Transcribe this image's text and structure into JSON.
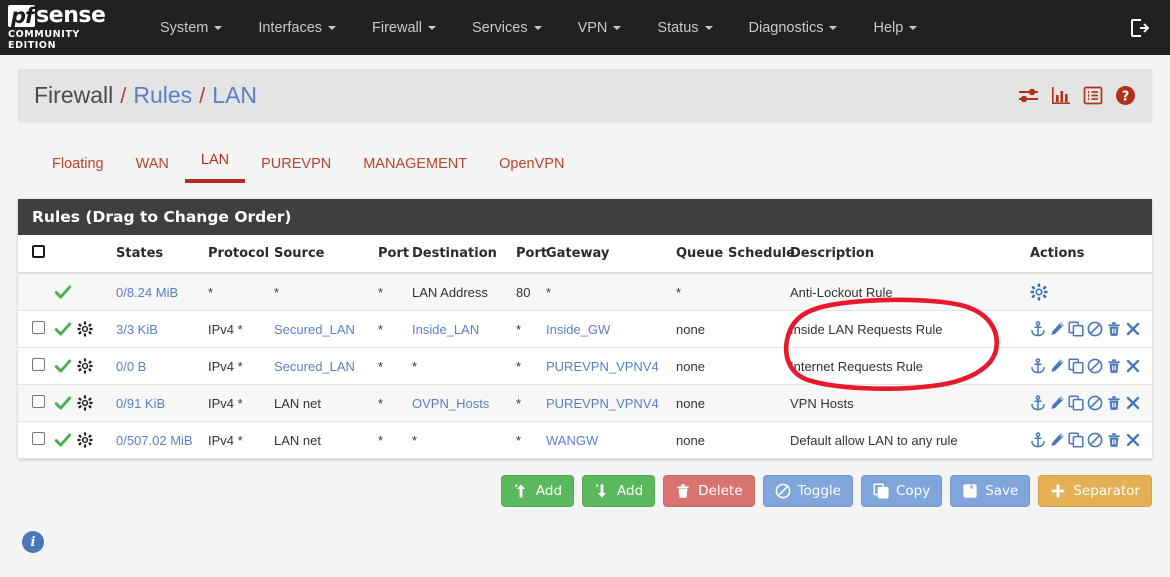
{
  "navbar": {
    "brand": {
      "pf": "pf",
      "sense": "sense",
      "edition": "COMMUNITY EDITION"
    },
    "items": [
      {
        "label": "System"
      },
      {
        "label": "Interfaces"
      },
      {
        "label": "Firewall"
      },
      {
        "label": "Services"
      },
      {
        "label": "VPN"
      },
      {
        "label": "Status"
      },
      {
        "label": "Diagnostics"
      },
      {
        "label": "Help"
      }
    ],
    "logout_icon": "logout-icon"
  },
  "page_head": {
    "crumbs": [
      {
        "label": "Firewall",
        "link": false
      },
      {
        "label": "Rules",
        "link": true
      },
      {
        "label": "LAN",
        "link": true
      }
    ],
    "separator": "/",
    "icons": [
      {
        "name": "sliders-icon"
      },
      {
        "name": "bar-chart-icon"
      },
      {
        "name": "list-icon"
      },
      {
        "name": "help-circle-icon"
      }
    ],
    "icon_color": "#b0301b"
  },
  "tabs": [
    {
      "label": "Floating",
      "active": false
    },
    {
      "label": "WAN",
      "active": false
    },
    {
      "label": "LAN",
      "active": true
    },
    {
      "label": "PUREVPN",
      "active": false
    },
    {
      "label": "MANAGEMENT",
      "active": false
    },
    {
      "label": "OpenVPN",
      "active": false
    }
  ],
  "panel": {
    "title": "Rules (Drag to Change Order)",
    "columns": [
      "",
      "",
      "States",
      "Protocol",
      "Source",
      "Port",
      "Destination",
      "Port",
      "Gateway",
      "Queue",
      "Schedule",
      "Description",
      "Actions"
    ],
    "rows": [
      {
        "checkbox": false,
        "pass": true,
        "gear": false,
        "states": "0/8.24 MiB",
        "protocol": "*",
        "source": "*",
        "source_link": false,
        "port1": "*",
        "destination": "LAN Address",
        "destination_link": false,
        "port2": "80",
        "gateway": "*",
        "gateway_link": false,
        "queue": "*",
        "schedule": "",
        "description": "Anti-Lockout Rule",
        "actions": [
          "gear-icon"
        ],
        "shaded": true
      },
      {
        "checkbox": true,
        "pass": true,
        "gear": true,
        "states": "3/3 KiB",
        "protocol": "IPv4 *",
        "source": "Secured_LAN",
        "source_link": true,
        "port1": "*",
        "destination": "Inside_LAN",
        "destination_link": true,
        "port2": "*",
        "gateway": "Inside_GW",
        "gateway_link": true,
        "queue": "none",
        "schedule": "",
        "description": "Inside LAN Requests Rule",
        "actions": [
          "anchor-icon",
          "pencil-icon",
          "copy-icon",
          "ban-icon",
          "trash-icon",
          "close-icon"
        ],
        "shaded": false
      },
      {
        "checkbox": true,
        "pass": true,
        "gear": true,
        "states": "0/0 B",
        "protocol": "IPv4 *",
        "source": "Secured_LAN",
        "source_link": true,
        "port1": "*",
        "destination": "*",
        "destination_link": false,
        "port2": "*",
        "gateway": "PUREVPN_VPNV4",
        "gateway_link": true,
        "queue": "none",
        "schedule": "",
        "description": "Internet Requests Rule",
        "actions": [
          "anchor-icon",
          "pencil-icon",
          "copy-icon",
          "ban-icon",
          "trash-icon",
          "close-icon"
        ],
        "shaded": false
      },
      {
        "checkbox": true,
        "pass": true,
        "gear": true,
        "states": "0/91 KiB",
        "protocol": "IPv4 *",
        "source": "LAN net",
        "source_link": false,
        "port1": "*",
        "destination": "OVPN_Hosts",
        "destination_link": true,
        "port2": "*",
        "gateway": "PUREVPN_VPNV4",
        "gateway_link": true,
        "queue": "none",
        "schedule": "",
        "description": "VPN Hosts",
        "actions": [
          "anchor-icon",
          "pencil-icon",
          "copy-icon",
          "ban-icon",
          "trash-icon",
          "close-icon"
        ],
        "shaded": true
      },
      {
        "checkbox": true,
        "pass": true,
        "gear": true,
        "states": "0/507.02 MiB",
        "protocol": "IPv4 *",
        "source": "LAN net",
        "source_link": false,
        "port1": "*",
        "destination": "*",
        "destination_link": false,
        "port2": "*",
        "gateway": "WANGW",
        "gateway_link": true,
        "queue": "none",
        "schedule": "",
        "description": "Default allow LAN to any rule",
        "actions": [
          "anchor-icon",
          "pencil-icon",
          "copy-icon",
          "ban-icon",
          "trash-icon",
          "close-icon"
        ],
        "shaded": false
      }
    ]
  },
  "buttons": [
    {
      "label": "Add",
      "icon": "arrow-up-icon",
      "style": "green"
    },
    {
      "label": "Add",
      "icon": "arrow-down-icon",
      "style": "green"
    },
    {
      "label": "Delete",
      "icon": "trash-icon",
      "style": "red"
    },
    {
      "label": "Toggle",
      "icon": "ban-icon",
      "style": "blue"
    },
    {
      "label": "Copy",
      "icon": "copy-icon",
      "style": "blue"
    },
    {
      "label": "Save",
      "icon": "save-icon",
      "style": "blue"
    },
    {
      "label": "Separator",
      "icon": "plus-icon",
      "style": "orange"
    }
  ],
  "footer": {
    "info_icon": "info-icon",
    "info_glyph": "i"
  },
  "annotation": {
    "type": "hand-drawn-ellipse",
    "color": "#e8192c",
    "encircles": [
      "Inside LAN Requests Rule",
      "Internet Requests Rule"
    ]
  }
}
